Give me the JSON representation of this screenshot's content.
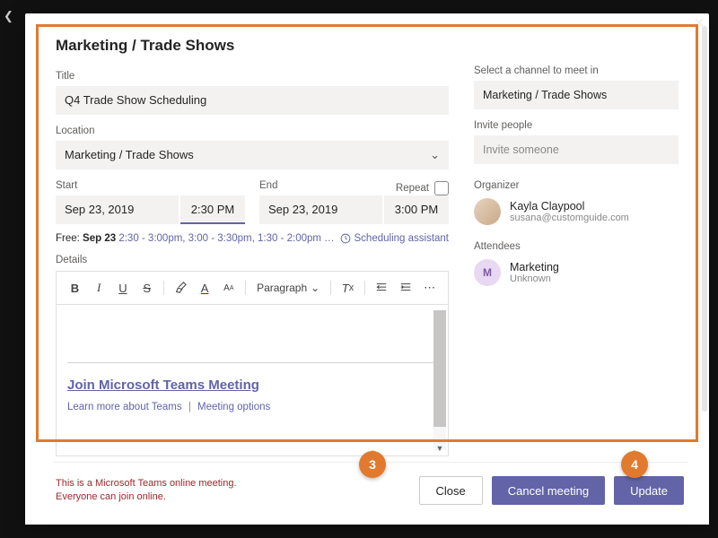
{
  "header": {
    "title": "Marketing / Trade Shows"
  },
  "left": {
    "title_label": "Title",
    "title_value": "Q4 Trade Show Scheduling",
    "location_label": "Location",
    "location_value": "Marketing / Trade Shows",
    "start_label": "Start",
    "start_date": "Sep 23, 2019",
    "start_time": "2:30 PM",
    "end_label": "End",
    "end_date": "Sep 23, 2019",
    "end_time": "3:00 PM",
    "repeat_label": "Repeat",
    "free_prefix": "Free: ",
    "free_date": "Sep 23",
    "free_slots": "2:30 - 3:00pm,  3:00 - 3:30pm,  1:30 - 2:00pm  …",
    "scheduling_assistant": "Scheduling assistant",
    "details_label": "Details",
    "toolbar": {
      "bold": "B",
      "italic": "I",
      "underline": "U",
      "strike": "S",
      "paragraph": "Paragraph"
    },
    "editor": {
      "join_link": "Join Microsoft Teams Meeting",
      "learn_more": "Learn more about Teams",
      "meeting_options": "Meeting options"
    }
  },
  "right": {
    "channel_label": "Select a channel to meet in",
    "channel_value": "Marketing / Trade Shows",
    "invite_label": "Invite people",
    "invite_placeholder": "Invite someone",
    "organizer_label": "Organizer",
    "organizer_name": "Kayla Claypool",
    "organizer_email": "susana@customguide.com",
    "attendees_label": "Attendees",
    "attendee_initial": "M",
    "attendee_name": "Marketing",
    "attendee_status": "Unknown"
  },
  "footer": {
    "note": "This is a Microsoft Teams online meeting. Everyone can join online.",
    "close": "Close",
    "cancel": "Cancel meeting",
    "update": "Update"
  },
  "callouts": {
    "c3": "3",
    "c4": "4"
  }
}
